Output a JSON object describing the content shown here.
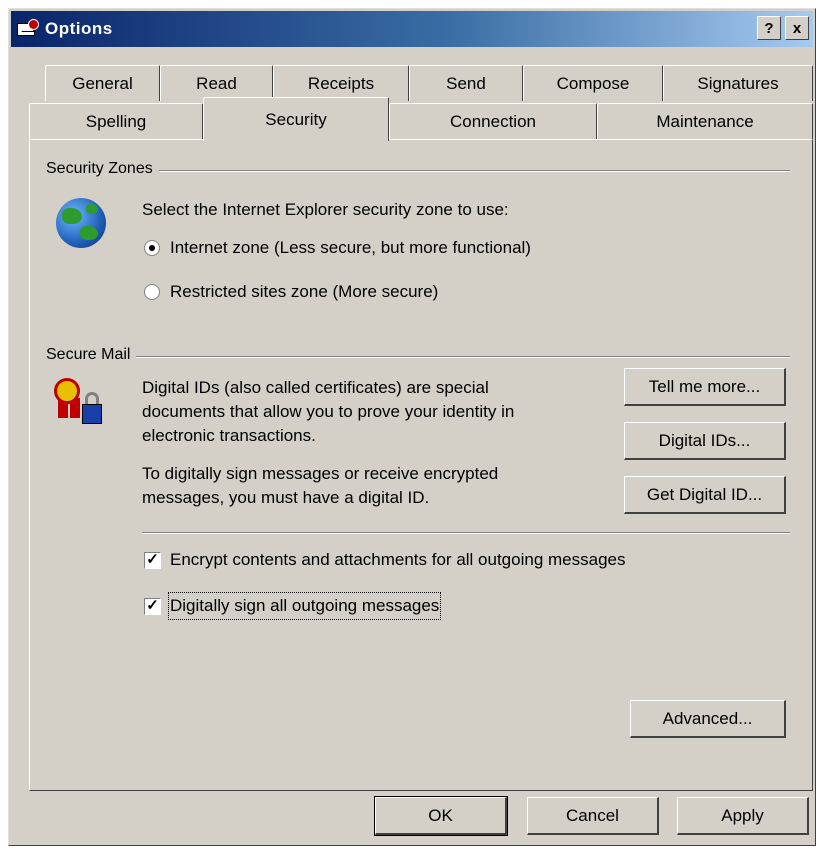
{
  "window": {
    "title": "Options",
    "help_label": "?",
    "close_label": "x"
  },
  "tabs": {
    "row1": [
      "General",
      "Read",
      "Receipts",
      "Send",
      "Compose",
      "Signatures"
    ],
    "row2": [
      "Spelling",
      "Security",
      "Connection",
      "Maintenance"
    ],
    "active": "Security"
  },
  "security_zones": {
    "heading": "Security Zones",
    "prompt": "Select the Internet Explorer security zone to use:",
    "options": [
      {
        "label": "Internet zone (Less secure, but more functional)",
        "checked": true
      },
      {
        "label": "Restricted sites zone (More secure)",
        "checked": false
      }
    ]
  },
  "secure_mail": {
    "heading": "Secure Mail",
    "description": [
      "Digital IDs (also called certificates) are special",
      "documents that allow you to prove your identity in",
      "electronic transactions."
    ],
    "sign_note": [
      "To digitally sign messages or receive encrypted",
      "messages, you must have a digital ID."
    ],
    "buttons": {
      "tell_me_more": "Tell me more...",
      "digital_ids": "Digital IDs...",
      "get_digital_id": "Get Digital ID..."
    },
    "checkboxes": [
      {
        "label": "Encrypt contents and attachments for all outgoing messages",
        "checked": true
      },
      {
        "label": "Digitally sign all outgoing messages",
        "checked": true
      }
    ]
  },
  "buttons": {
    "advanced": "Advanced...",
    "ok": "OK",
    "cancel": "Cancel",
    "apply": "Apply"
  }
}
